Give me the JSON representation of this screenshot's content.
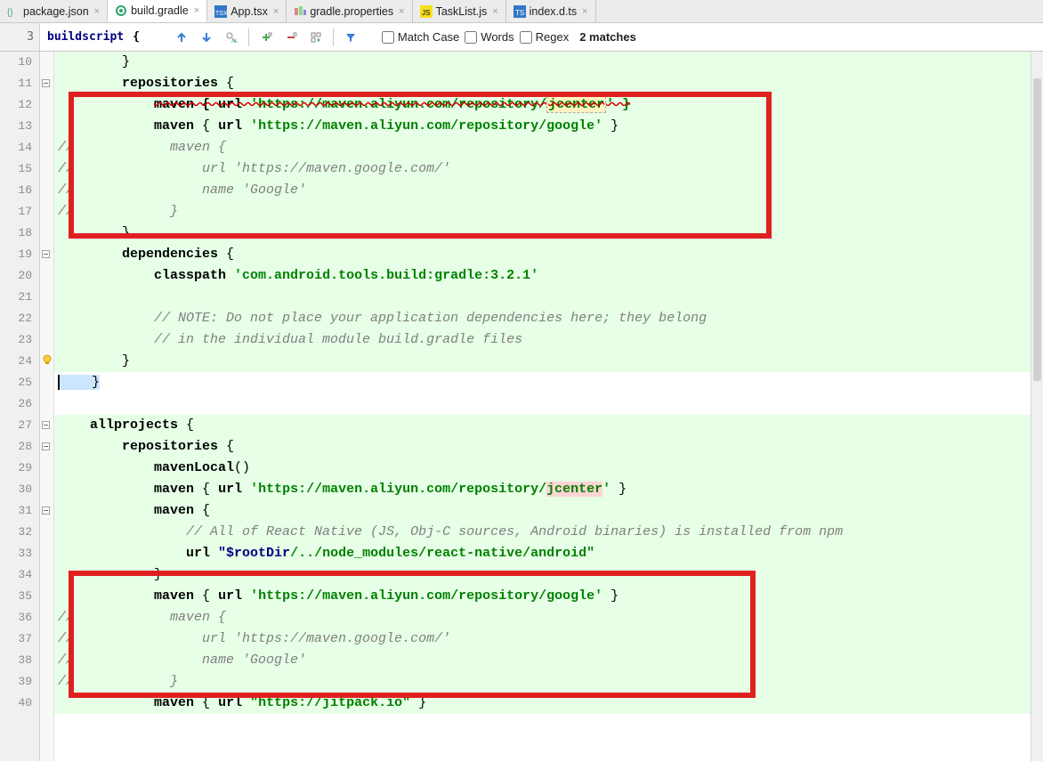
{
  "tabs": [
    {
      "name": "package.json",
      "icon": "json"
    },
    {
      "name": "build.gradle",
      "icon": "gradle",
      "active": true
    },
    {
      "name": "App.tsx",
      "icon": "tsx"
    },
    {
      "name": "gradle.properties",
      "icon": "props"
    },
    {
      "name": "TaskList.js",
      "icon": "js"
    },
    {
      "name": "index.d.ts",
      "icon": "ts"
    }
  ],
  "breadcrumb": {
    "lineNo": "3",
    "kw": "buildscript",
    "brace": "{"
  },
  "findbar": {
    "match_case": "Match Case",
    "words": "Words",
    "regex": "Regex",
    "matches": "2 matches"
  },
  "gutter": [
    "10",
    "11",
    "12",
    "13",
    "14",
    "15",
    "16",
    "17",
    "18",
    "19",
    "20",
    "21",
    "22",
    "23",
    "24",
    "25",
    "26",
    "27",
    "28",
    "29",
    "30",
    "31",
    "32",
    "33",
    "34",
    "35",
    "36",
    "37",
    "38",
    "39",
    "40"
  ],
  "code": {
    "l10": "        }",
    "l11a": "        ",
    "l11b": "repositories",
    " l11c": " {",
    "l12a": "            ",
    "l12b": "maven { ",
    "l12c": "url",
    "l12d": " 'https://maven.aliyun.com/repository/",
    "l12e": "jcenter",
    "l12f": "' }",
    "l13a": "            ",
    "l13b": "maven",
    " l13c": " { ",
    "l13d": "url ",
    "l13e": "'https://maven.aliyun.com/repository/google'",
    "l13f": " }",
    "l14": "//            maven {",
    "l15": "//                url 'https://maven.google.com/'",
    "l16": "//                name 'Google'",
    "l17": "//            }",
    "l18": "        }",
    "l19a": "        ",
    "l19b": "dependencies",
    "l19c": " {",
    "l20a": "            ",
    "l20b": "classpath ",
    "l20c": "'com.android.tools.build:gradle:3.2.1'",
    "l21": "",
    "l22": "            // NOTE: Do not place your application dependencies here; they belong",
    "l23": "            // in the individual module build.gradle files",
    "l24": "        }",
    "l25": "    }",
    "l26": "",
    "l27a": "    ",
    "l27b": "allprojects",
    "l27c": " {",
    "l28a": "        ",
    "l28b": "repositories",
    "l28c": " {",
    "l29a": "            ",
    "l29b": "mavenLocal",
    "l29c": "()",
    "l30a": "            ",
    "l30b": "maven",
    "l30c": " { ",
    "l30d": "url ",
    "l30e": "'https://maven.aliyun.com/repository/",
    "l30f": "jcenter",
    "l30g": "'",
    "l30h": " }",
    "l31a": "            ",
    "l31b": "maven",
    "l31c": " {",
    "l32": "                // All of React Native (JS, Obj-C sources, Android binaries) is installed from npm",
    "l33a": "                ",
    "l33b": "url ",
    "l33c": "\"$rootDir",
    "l33d": "/../node_modules/react-native/android\"",
    "l34": "            }",
    "l35a": "            ",
    "l35b": "maven",
    "l35c": " { ",
    "l35d": "url ",
    "l35e": "'https://maven.aliyun.com/repository/google'",
    "l35f": " }",
    "l36": "//            maven {",
    "l37": "//                url 'https://maven.google.com/'",
    "l38": "//                name 'Google'",
    "l39": "//            }",
    "l40a": "            ",
    "l40b": "maven",
    "l40c": " { ",
    "l40d": "url ",
    "l40e": "\"https://jitpack.io\"",
    "l40f": " }"
  }
}
